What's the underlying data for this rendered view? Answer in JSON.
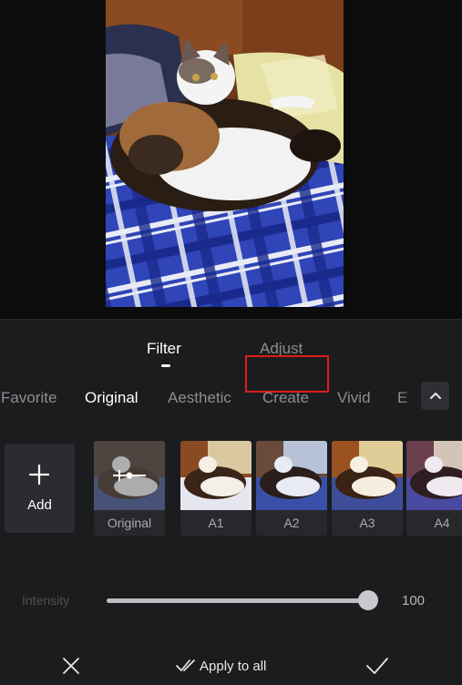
{
  "preview": {
    "subject_icon": "cat-photo"
  },
  "editor_tabs": {
    "filter_label": "Filter",
    "adjust_label": "Adjust",
    "active": "Filter"
  },
  "categories": [
    "Favorite",
    "Original",
    "Aesthetic",
    "Create",
    "Vivid",
    "E"
  ],
  "active_category": "Original",
  "collapse_icon": "chevron-up-icon",
  "add_tile": {
    "label": "Add",
    "icon": "plus-icon"
  },
  "filters": [
    {
      "label": "Original",
      "tint": "#8a7f77"
    },
    {
      "label": "A1",
      "tint": "#d9b48f"
    },
    {
      "label": "A2",
      "tint": "#8aa0c8"
    },
    {
      "label": "A3",
      "tint": "#d8b27e"
    },
    {
      "label": "A4",
      "tint": "#b9a0b9"
    }
  ],
  "intensity": {
    "label": "Intensity",
    "value": "100",
    "fraction": 1.0
  },
  "bottom_bar": {
    "close_icon": "close-icon",
    "apply_all_icon": "double-check-icon",
    "apply_all_label": "Apply to all",
    "confirm_icon": "check-icon"
  },
  "colors": {
    "highlight": "#e01b1b",
    "panel": "#1b1c1e"
  }
}
